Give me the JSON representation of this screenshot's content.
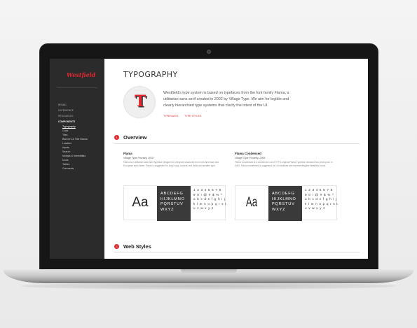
{
  "sidebar": {
    "logo": "Westfield",
    "nav": [
      {
        "label": "BRAND",
        "active": false
      },
      {
        "label": "EXPERIENCE",
        "active": false
      },
      {
        "label": "RESOURCES",
        "active": false
      },
      {
        "label": "COMPONENTS",
        "active": true
      }
    ],
    "sub_nav": [
      "Typography",
      "Color",
      "Tiles",
      "Banners & Title Blocks",
      "Loaders",
      "Inputs",
      "Search",
      "Modals & Interstitials",
      "Icons",
      "Tables",
      "Carousels"
    ]
  },
  "main": {
    "title": "TYPOGRAPHY",
    "hero_letter": "T",
    "intro_line1": "Westfield's type system is based on typefaces from the font family Flama, a",
    "intro_line2": "utilitarian sans serif created in 2002 by Village Type. We aim for legible and",
    "intro_line3": "clearly hierarchied type systems that clarify the intent of the UI.",
    "links": [
      "TYPEFACES",
      "TYPE STYLES"
    ],
    "sections": [
      {
        "number": "1",
        "title": "Overview"
      },
      {
        "number": "2",
        "title": "Web Styles"
      }
    ],
    "fonts": [
      {
        "name": "Flama",
        "foundry": "Village Type Foundry, 2002",
        "desc": "Flama is a utilitarian sans serif typeface designed to integrate structures from both American and European sans faces. Flama is suggested for body copy, content, text fields and smaller type.",
        "sample": "Aa",
        "upper1": "ABCDEFG",
        "upper2": "HIJKLMNO",
        "upper3": "PQRSTUV",
        "upper4": "WXYZ",
        "digits1": "1 2 3 4 5 6 7 8",
        "digits2": "9 0 ! @ # $ % ^",
        "lower1": "a b c d e f g h i j",
        "lower2": "k l m n o p q r s t",
        "lower3": "u v w x y z"
      },
      {
        "name": "Flama Condensed",
        "foundry": "Village Type Foundry, 2005",
        "desc": "Flama Condensed is a condensed cut of VTF's original Flama Typeface released two years prior, in 2002. Flama condensed is suggested for UI headlines and representing the Westfield brand.",
        "sample": "Aa",
        "upper1": "ABCDEFG",
        "upper2": "HIJKLMNO",
        "upper3": "PQRSTUV",
        "upper4": "WXYZ",
        "digits1": "1 2 3 4 5 6 7 8",
        "digits2": "9 0 ! @ # $ % ^",
        "lower1": "a b c d e f g h i j",
        "lower2": "k l m n o p q r s t",
        "lower3": "u v w x y z"
      }
    ]
  },
  "colors": {
    "accent": "#e0282e",
    "sidebar_bg": "#2b2b2b",
    "specimen_dark": "#3a3a3a"
  }
}
